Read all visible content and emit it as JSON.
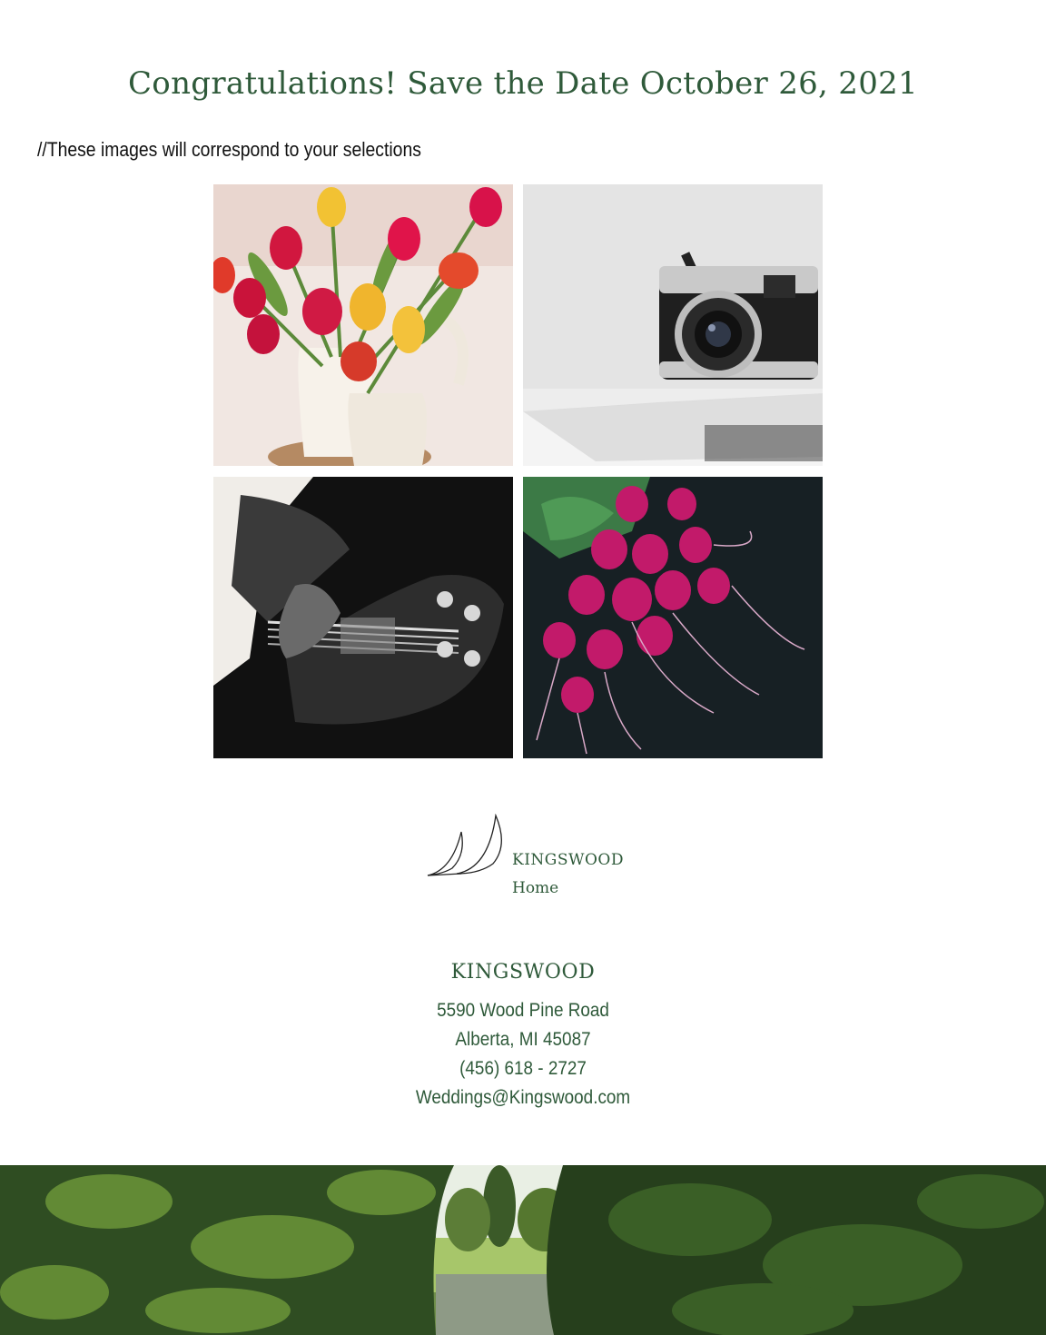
{
  "header": {
    "title": "Congratulations! Save the Date October 26, 2021"
  },
  "note": "//These images will correspond to your selections",
  "gallery": {
    "images": [
      {
        "subject": "tulips-in-pitchers"
      },
      {
        "subject": "camera-on-table"
      },
      {
        "subject": "bass-guitar"
      },
      {
        "subject": "radishes"
      }
    ]
  },
  "logo": {
    "name": "KINGSWOOD",
    "sub": "Home"
  },
  "contact": {
    "name": "KINGSWOOD",
    "street": "5590 Wood Pine Road",
    "city": "Alberta, MI 45087",
    "phone": "(456) 618 - 2727",
    "email": "Weddings@Kingswood.com"
  },
  "colors": {
    "accent": "#2f5a3a",
    "text": "#111111",
    "background": "#ffffff"
  }
}
